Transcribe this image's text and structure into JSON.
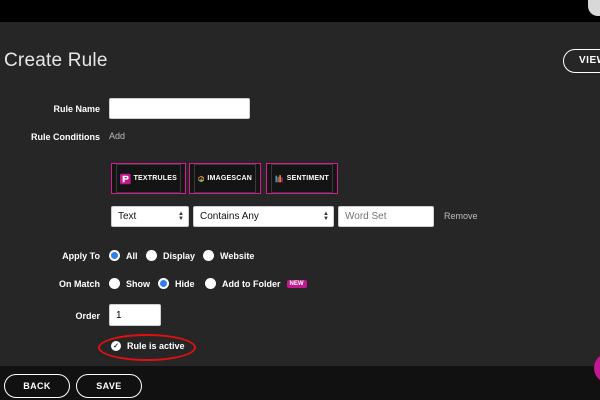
{
  "header": {
    "title": "Create Rule",
    "view_button": "VIEW"
  },
  "form": {
    "rule_name": {
      "label": "Rule Name",
      "value": ""
    },
    "rule_conditions": {
      "label": "Rule Conditions",
      "add_link": "Add"
    },
    "engines": [
      {
        "label": "TEXTRULES",
        "icon": "textrules-icon"
      },
      {
        "label": "IMAGESCAN",
        "icon": "imagescan-icon"
      },
      {
        "label": "SENTIMENT",
        "icon": "sentiment-icon"
      }
    ],
    "condition_row": {
      "field_select": "Text",
      "operator_select": "Contains Any",
      "value_placeholder": "Word Set",
      "remove_link": "Remove"
    },
    "apply_to": {
      "label": "Apply To",
      "options": [
        {
          "label": "All",
          "checked": true
        },
        {
          "label": "Display",
          "checked": false
        },
        {
          "label": "Website",
          "checked": false
        }
      ]
    },
    "on_match": {
      "label": "On Match",
      "options": [
        {
          "label": "Show",
          "checked": false
        },
        {
          "label": "Hide",
          "checked": true
        },
        {
          "label": "Add to Folder",
          "checked": false
        }
      ],
      "new_badge": "NEW"
    },
    "order": {
      "label": "Order",
      "value": "1"
    },
    "rule_active": {
      "label": "Rule is active",
      "checked": true
    }
  },
  "footer": {
    "back_button": "BACK",
    "save_button": "SAVE"
  },
  "colors": {
    "background": "#262626",
    "accent_magenta": "#c2188f",
    "radio_selected": "#2f80ed",
    "highlight_red": "#e01010"
  }
}
